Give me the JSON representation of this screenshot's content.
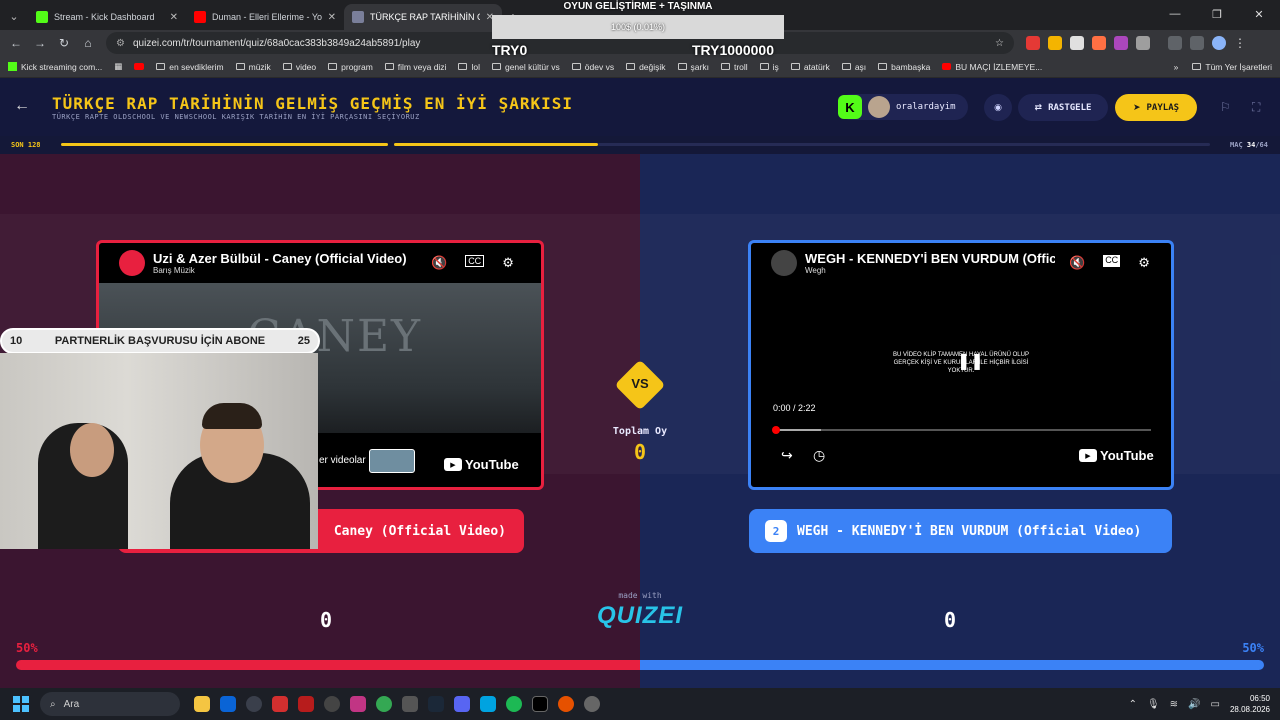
{
  "browser": {
    "tabs": [
      {
        "title": "Stream - Kick Dashboard",
        "color": "#53fc18"
      },
      {
        "title": "Duman - Elleri Ellerime - YouTu",
        "color": "#ff0000"
      },
      {
        "title": "TÜRKÇE RAP TARİHİNİN GELMİ",
        "color": "#7a7f9a"
      }
    ],
    "url": "quizei.com/tr/tournament/quiz/68a0cac383b3849a24ab5891/play",
    "bookmarks": [
      "Kick streaming com...",
      "en sevdiklerim",
      "müzik",
      "video",
      "program",
      "film veya dizi",
      "lol",
      "genel kültür vs",
      "ödev vs",
      "değişik",
      "şarkı",
      "troll",
      "iş",
      "atatürk",
      "aşı",
      "bambaşka",
      "BU MAÇI İZLEMEYE..."
    ],
    "all_bookmarks": "Tüm Yer İşaretleri"
  },
  "overlay": {
    "title": "OYUN GELİŞTİRME + TAŞINMA",
    "progress": "100$ (0.01%)",
    "min": "TRY0",
    "max": "TRY1000000"
  },
  "quiz": {
    "title": "TÜRKÇE RAP TARİHİNİN GELMİŞ GEÇMİŞ EN İYİ ŞARKISI",
    "subtitle": "TÜRKÇE RAPTE OLDSCHOOL VE NEWSCHOOL KARIŞIK TARİHİN EN İYİ PARÇASINI SEÇİYORUZ",
    "username": "oralardayim",
    "rastgele": "RASTGELE",
    "paylas": "PAYLAŞ",
    "round": "SON 128",
    "match_label": "MAÇ",
    "match_current": "34",
    "match_total": "/64",
    "progress_fraction": 34,
    "vs": "VS",
    "total_label": "Toplam Oy",
    "total_value": "0",
    "made_with": "made with",
    "brand": "QUIZEI",
    "left": {
      "video_title": "Uzi & Azer Bülbül - Caney (Official Video)",
      "channel": "Barış Müzik",
      "scene_text": "CANEY",
      "more_videos": "er videolar",
      "name": "Caney (Official Video)",
      "votes": "0",
      "percent": "50%"
    },
    "right": {
      "video_title": "WEGH - KENNEDY'İ BEN VURDUM (Offici",
      "channel": "Wegh",
      "disclaimer": "BU VİDEO KLİP TAMAMEN HAYAL ÜRÜNÜ OLUP GERÇEK KİŞİ VE KURUMLAR İLE HİÇBİR İLGİSİ YOKTUR.",
      "time": "0:00 / 2:22",
      "number": "2",
      "name": "WEGH - KENNEDY'İ BEN VURDUM (Official Video)",
      "votes": "0",
      "percent": "50%"
    },
    "youtube": "YouTube"
  },
  "stream": {
    "goal_current": "10",
    "goal_text": "PARTNERLİK BAŞVURUSU İÇİN ABONE",
    "goal_target": "25"
  },
  "taskbar": {
    "search": "Ara",
    "time": "06:50",
    "date": "28.08.2026"
  }
}
